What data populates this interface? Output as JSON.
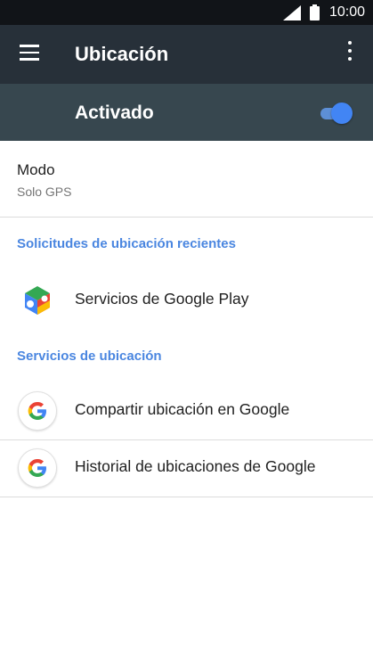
{
  "status": {
    "time": "10:00"
  },
  "appbar": {
    "title": "Ubicación"
  },
  "master": {
    "label": "Activado",
    "enabled": true
  },
  "mode": {
    "title": "Modo",
    "value": "Solo GPS"
  },
  "recent": {
    "header": "Solicitudes de ubicación recientes",
    "items": [
      {
        "label": "Servicios de Google Play",
        "icon": "google-play-services-icon"
      }
    ]
  },
  "services": {
    "header": "Servicios de ubicación",
    "items": [
      {
        "label": "Compartir ubicación en Google",
        "icon": "google-icon"
      },
      {
        "label": "Historial de ubicaciones de Google",
        "icon": "google-icon"
      }
    ]
  },
  "colors": {
    "statusbar": "#111418",
    "appbar": "#273039",
    "masterbar": "#37474f",
    "accent": "#4285f4",
    "section": "#4a86e0"
  }
}
